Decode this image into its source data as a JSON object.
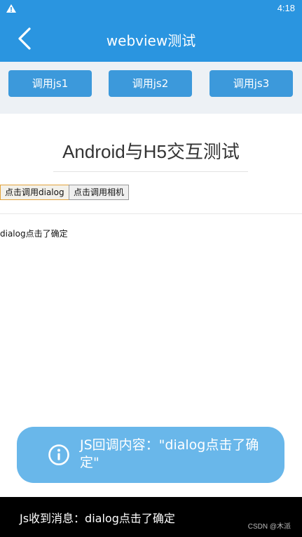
{
  "status_bar": {
    "time": "4:18"
  },
  "app_bar": {
    "title": "webview测试"
  },
  "js_buttons": [
    "调用js1",
    "调用js2",
    "调用js3"
  ],
  "webpage": {
    "heading": "Android与H5交互测试",
    "buttons": [
      "点击调用dialog",
      "点击调用相机"
    ],
    "result": "dialog点击了确定"
  },
  "toast": {
    "message": "JS回调内容：\"dialog点击了确定\""
  },
  "snackbar": {
    "message": "Js收到消息：dialog点击了确定",
    "watermark": "CSDN @木派"
  },
  "colors": {
    "primary": "#2a95e0",
    "button": "#3c99db",
    "toast": "#69b7ea"
  }
}
